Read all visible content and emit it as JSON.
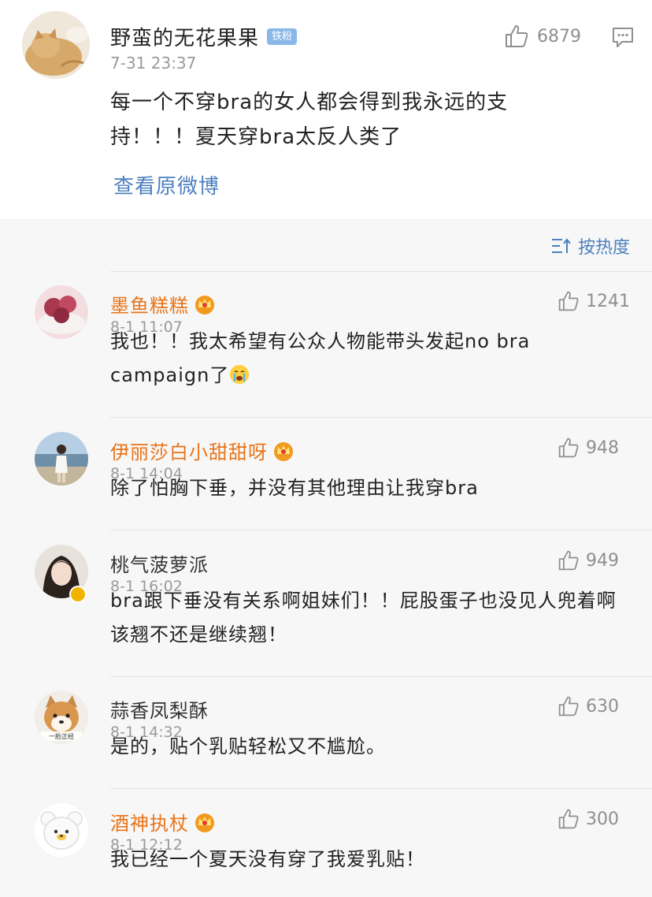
{
  "main_post": {
    "author": "野蛮的无花果果",
    "badge": "铁粉",
    "time": "7-31 23:37",
    "like_count": "6879",
    "text": "每一个不穿bra的女人都会得到我永远的支持！！！夏天穿bra太反人类了",
    "view_original": "查看原微博",
    "icons": [
      "avatar-cat",
      "thumbs-up-icon",
      "comment-icon"
    ]
  },
  "sort": {
    "label": "按热度",
    "icon": "sort-icon"
  },
  "comments": [
    {
      "name": "墨鱼糕糕",
      "vip": true,
      "time": "8-1 11:07",
      "likes": "1241",
      "text": "我也！！我太希望有公众人物能带头发起no bra campaign了",
      "emoji": "crying-emoji"
    },
    {
      "name": "伊丽莎白小甜甜呀",
      "vip": true,
      "time": "8-1 14:04",
      "likes": "948",
      "text": "除了怕胸下垂，并没有其他理由让我穿bra"
    },
    {
      "name": "桃气菠萝派",
      "vip": false,
      "verified": true,
      "time": "8-1 16:02",
      "likes": "949",
      "text": "bra跟下垂没有关系啊姐妹们！！屁股蛋子也没见人兜着啊该翘不还是继续翘！"
    },
    {
      "name": "蒜香凤梨酥",
      "vip": false,
      "time": "8-1 14:32",
      "likes": "630",
      "text": "是的，贴个乳贴轻松又不尴尬。",
      "avatar_caption": "一脸正经"
    },
    {
      "name": "酒神执杖",
      "vip": true,
      "time": "8-1 12:12",
      "likes": "300",
      "text": "我已经一个夏天没有穿了我爱乳贴！"
    }
  ],
  "colors": {
    "link": "#4c7fbf",
    "vip_name": "#e8741a",
    "meta": "#9a9a9a",
    "badge": "#8ab6e8",
    "comments_bg": "#f7f7f7"
  }
}
